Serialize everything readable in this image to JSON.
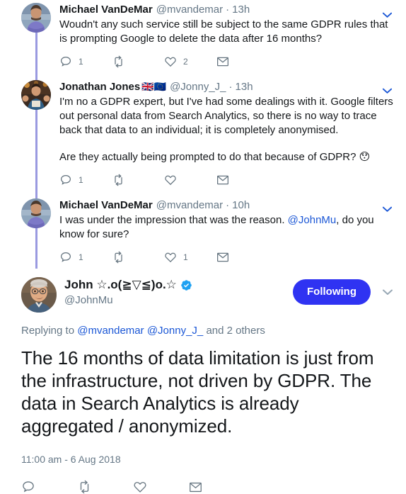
{
  "app": "twitter-thread",
  "colors": {
    "link": "#1b57d6",
    "muted": "#657786",
    "text": "#14171a",
    "follow_button": "#2f33f2",
    "thread_line": "#9a9ae0",
    "verified": "#1da1f2",
    "icon": "#667580"
  },
  "replies": [
    {
      "fullname": "Michael VanDeMar",
      "name_emoji": "",
      "handle": "@mvandemar",
      "separator": "·",
      "time": "13h",
      "paragraphs": [
        "Woudn't any such service still be subject to the same GDPR rules that is prompting Google to delete the data after 16 months?"
      ],
      "actions": {
        "reply_label": "reply",
        "reply_count": "1",
        "retweet_label": "retweet",
        "retweet_count": "",
        "like_label": "like",
        "like_count": "2",
        "dm_label": "direct-message",
        "dm_count": ""
      },
      "caret": "chevron-down"
    },
    {
      "fullname": "Jonathan Jones",
      "name_emoji": "🇬🇧🇪🇺",
      "handle": "@Jonny_J_",
      "separator": "·",
      "time": "13h",
      "paragraphs": [
        "I'm no a GDPR expert, but I've had some dealings with it. Google filters out personal data from Search Analytics, so there is no way to trace back that data to an individual; it is completely anonymised.",
        "Are they actually being prompted to do that because of GDPR? 😯"
      ],
      "actions": {
        "reply_label": "reply",
        "reply_count": "1",
        "retweet_label": "retweet",
        "retweet_count": "",
        "like_label": "like",
        "like_count": "",
        "dm_label": "direct-message",
        "dm_count": ""
      },
      "caret": "chevron-down"
    },
    {
      "fullname": "Michael VanDeMar",
      "name_emoji": "",
      "handle": "@mvandemar",
      "separator": "·",
      "time": "10h",
      "paragraphs": [
        "I was under the impression that was the reason. @JohnMu, do you know for sure?"
      ],
      "text_parts": [
        {
          "type": "text",
          "value": "I was under the impression that was the reason. "
        },
        {
          "type": "mention",
          "value": "@JohnMu"
        },
        {
          "type": "text",
          "value": ", do you know for sure?"
        }
      ],
      "actions": {
        "reply_label": "reply",
        "reply_count": "1",
        "retweet_label": "retweet",
        "retweet_count": "",
        "like_label": "like",
        "like_count": "1",
        "dm_label": "direct-message",
        "dm_count": ""
      },
      "caret": "chevron-down"
    }
  ],
  "main_tweet": {
    "fullname": "John ☆.o(≧▽≦)o.☆",
    "handle": "@JohnMu",
    "verified": true,
    "verified_icon": "verified-badge-icon",
    "follow_button_label": "Following",
    "caret": "chevron-down",
    "replying_to_prefix": "Replying to",
    "replying_to_mentions": [
      "@mvandemar",
      "@Jonny_J_"
    ],
    "replying_to_suffix": "and 2 others",
    "text": "The 16 months of data limitation is just from the infrastructure, not driven by GDPR. The data in Search Analytics is already aggregated / anonymized.",
    "timestamp": "11:00 am - 6 Aug 2018",
    "actions": {
      "reply_label": "reply",
      "reply_count": "",
      "retweet_label": "retweet",
      "retweet_count": "",
      "like_label": "like",
      "like_count": "",
      "dm_label": "direct-message",
      "dm_count": ""
    }
  },
  "icons": {
    "reply": "reply-icon",
    "retweet": "retweet-icon",
    "like": "heart-icon",
    "dm": "envelope-icon",
    "chevron": "chevron-down-icon"
  }
}
